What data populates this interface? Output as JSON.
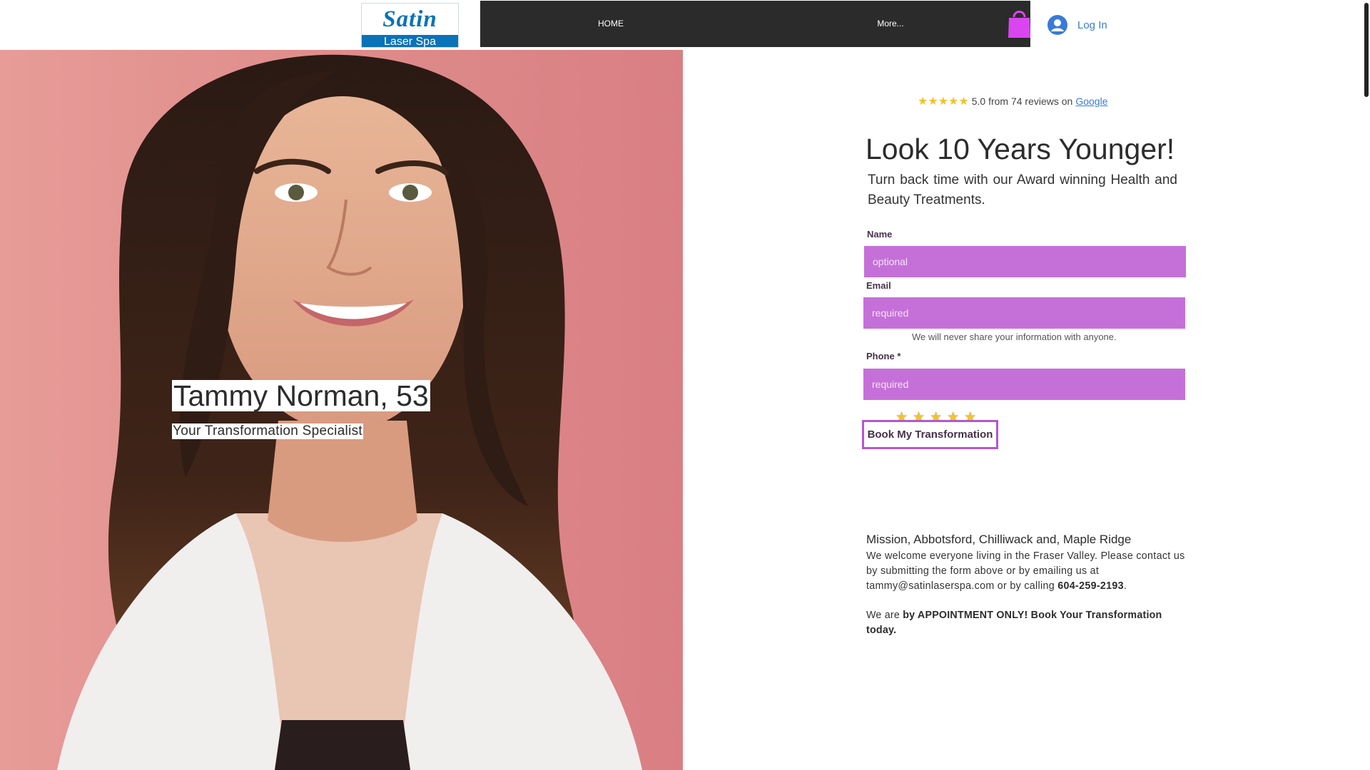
{
  "header": {
    "logo": {
      "line1": "Satin",
      "line2": "Laser Spa"
    },
    "nav": [
      {
        "label": "HOME"
      },
      {
        "label": "More..."
      }
    ],
    "cart_icon": "shopping-bag-icon",
    "login_label": "Log In",
    "accent_nav_bg": "#2b2b2b",
    "cart_color": "#d946ef"
  },
  "hero": {
    "name": "Tammy Norman, 53",
    "title": "Your Transformation Specialist"
  },
  "reviews": {
    "stars": "★★★★★",
    "text": "5.0 from 74 reviews on",
    "link": "Google"
  },
  "main": {
    "headline": "Look 10 Years Younger!",
    "subhead": "Turn back time with our Award winning Health and Beauty Treatments."
  },
  "form": {
    "name_label": "Name",
    "name_placeholder": "optional",
    "email_label": "Email",
    "email_placeholder": "required",
    "privacy_note": "We will never share your information with anyone.",
    "phone_label": "Phone *",
    "phone_placeholder": "required",
    "rating_stars": "★★★★★",
    "submit_label": "Book My Transformation",
    "field_color": "#c570d9"
  },
  "contact": {
    "locations": "Mission, Abbotsford, Chilliwack and, Maple Ridge",
    "para_text": "We welcome everyone living in the Fraser Valley. Please contact us by submitting the form above or by emailing us at tammy@satinlaserspa.com or by calling ",
    "phone": "604-259-2193",
    "para_end": ".",
    "appointment_prefix": "We are ",
    "appointment_bold": "by APPOINTMENT ONLY! Book Your Transformation today."
  }
}
